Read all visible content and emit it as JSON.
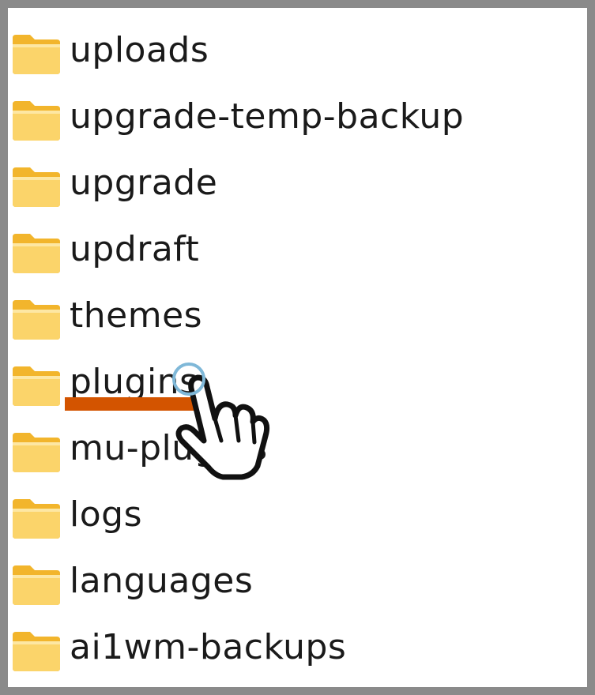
{
  "folders": [
    {
      "name": "uploads"
    },
    {
      "name": "upgrade-temp-backup"
    },
    {
      "name": "upgrade"
    },
    {
      "name": "updraft"
    },
    {
      "name": "themes"
    },
    {
      "name": "plugins"
    },
    {
      "name": "mu-plugins"
    },
    {
      "name": "logs"
    },
    {
      "name": "languages"
    },
    {
      "name": "ai1wm-backups"
    }
  ],
  "highlight": {
    "folder": "plugins",
    "underline_color": "#d35400",
    "click_ring_color": "#7fb8d8"
  },
  "colors": {
    "folder_body": "#f7c948",
    "folder_light": "#fde39a",
    "folder_edge": "#e0a800",
    "frame": "#8a8a8a"
  }
}
